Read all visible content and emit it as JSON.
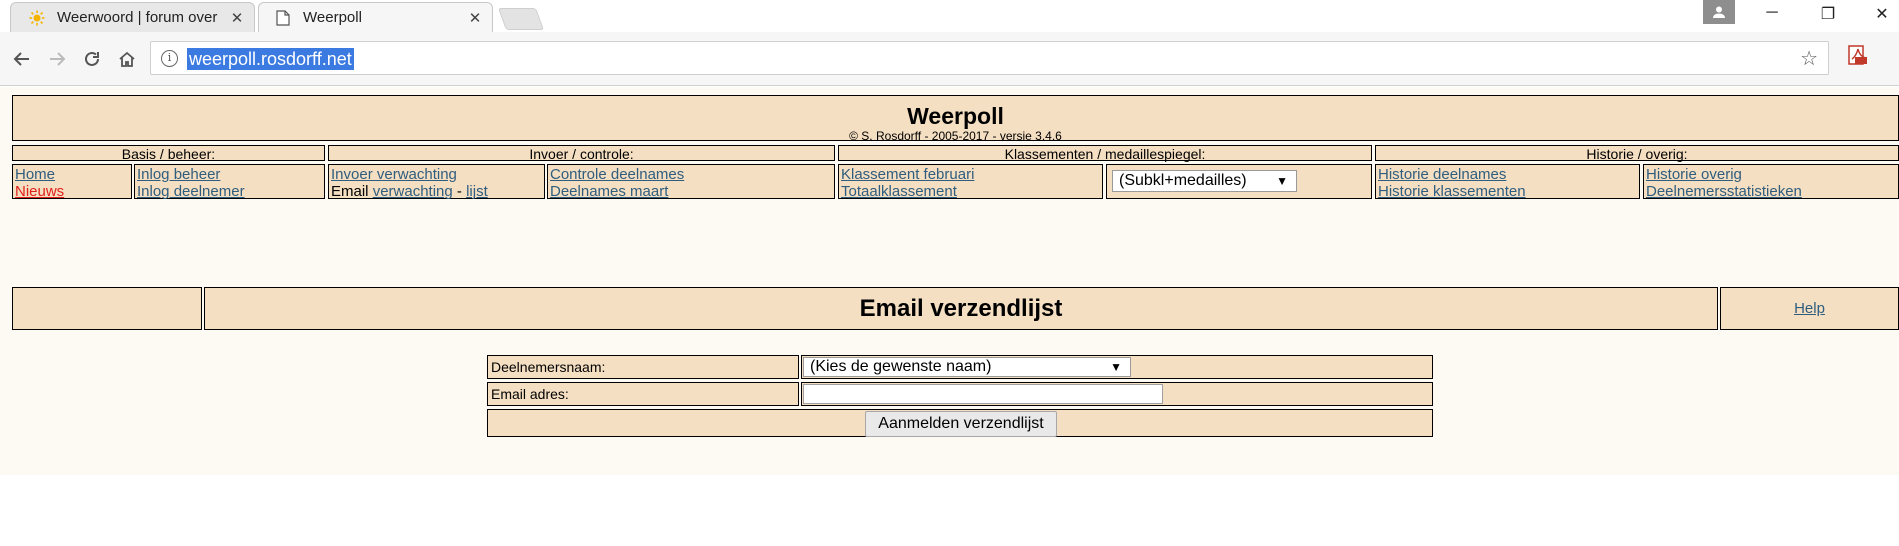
{
  "browser": {
    "tabs": [
      {
        "title": "Weerwoord | forum over",
        "active": false
      },
      {
        "title": "Weerpoll",
        "active": true
      }
    ],
    "tab_close": "✕",
    "url": "weerpoll.rosdorff.net",
    "window_controls": {
      "minimize": "─",
      "restore": "❐",
      "close": "✕"
    }
  },
  "header": {
    "title": "Weerpoll",
    "subtitle": "© S. Rosdorff - 2005-2017 - versie 3.4.6"
  },
  "sections": [
    "Basis / beheer:",
    "Invoer / controle:",
    "Klassementen / medaillespiegel:",
    "Historie / overig:"
  ],
  "nav": {
    "home": "Home",
    "nieuws": "Nieuws",
    "inlog_beheer": "Inlog beheer",
    "inlog_deelnemer": "Inlog deelnemer",
    "invoer_verwachting": "Invoer verwachting",
    "email_prefix": "Email",
    "email_verwachting": "verwachting",
    "email_sep": "-",
    "email_lijst": "lijst",
    "controle_deelnames": "Controle deelnames",
    "deelnames_maart": "Deelnames maart",
    "klassement_februari": "Klassement februari",
    "totaalklassement": "Totaalklassement",
    "subklasse_select": "(Subkl+medailles)",
    "historie_deelnames": "Historie deelnames",
    "historie_klassementen": "Historie klassementen",
    "historie_overig": "Historie overig",
    "deelnemersstatistieken": "Deelnemersstatistieken"
  },
  "main": {
    "title": "Email verzendlijst",
    "help": "Help"
  },
  "form": {
    "name_label": "Deelnemersnaam:",
    "name_select": "(Kies de gewenste naam)",
    "email_label": "Email adres:",
    "email_value": "",
    "submit": "Aanmelden verzendlijst"
  }
}
